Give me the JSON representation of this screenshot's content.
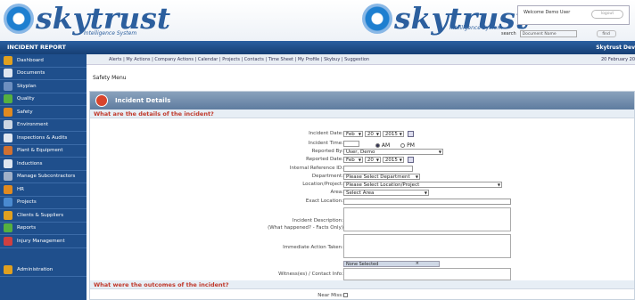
{
  "brand": {
    "name": "skytrust",
    "tagline": "Intelligence System"
  },
  "welcome": {
    "text": "Welcome Demo User",
    "logout_label": "logout"
  },
  "search": {
    "label": "search",
    "placeholder": "Document Name",
    "button": "find"
  },
  "topbar": {
    "title": "INCIDENT REPORT",
    "right": "Skytrust Dev"
  },
  "navlinks": {
    "items": "Alerts  |  My Actions  |  Company Actions  |  Calendar  |  Projects  |  Contacts  |  Time Sheet  |  My Profile  |  Skybuy  |  Suggestion",
    "date": "20 February 20"
  },
  "sidebar": {
    "items": [
      {
        "label": "Dashboard",
        "color": "#e0a020"
      },
      {
        "label": "Documents",
        "color": "#dfe6f0"
      },
      {
        "label": "Skyplan",
        "color": "#6d8fc0"
      },
      {
        "label": "Quality",
        "color": "#55b040"
      },
      {
        "label": "Safety",
        "color": "#e08a20"
      },
      {
        "label": "Environment",
        "color": "#cdd6e2"
      },
      {
        "label": "Inspections & Audits",
        "color": "#dfe6f0"
      },
      {
        "label": "Plant & Equipment",
        "color": "#d07030"
      },
      {
        "label": "Inductions",
        "color": "#dfe6f0"
      },
      {
        "label": "Manage Subcontractors",
        "color": "#a0b0c8"
      },
      {
        "label": "HR",
        "color": "#e08a20"
      },
      {
        "label": "Projects",
        "color": "#4a8ad0"
      },
      {
        "label": "Clients & Suppliers",
        "color": "#e0a020"
      },
      {
        "label": "Reports",
        "color": "#55b040"
      },
      {
        "label": "Injury Management",
        "color": "#d04040"
      }
    ],
    "admin": {
      "label": "Administration",
      "color": "#e0a020"
    }
  },
  "safety_menu": "Safety Menu",
  "panel": {
    "title": "Incident Details"
  },
  "q1": "What are the details of the incident?",
  "q2": "What were the outcomes of the incident?",
  "form": {
    "incident_date": {
      "label": "Incident Date:",
      "month": "Feb",
      "day": "20",
      "year": "2015"
    },
    "incident_time": {
      "label": "Incident Time:",
      "am": "AM",
      "pm": "PM",
      "selected": "AM"
    },
    "reported_by": {
      "label": "Reported By:",
      "value": "User, Demo"
    },
    "reported_date": {
      "label": "Reported Date:",
      "month": "Feb",
      "day": "20",
      "year": "2015"
    },
    "internal_ref": {
      "label": "Internal Reference ID:",
      "value": ""
    },
    "department": {
      "label": "Department:",
      "value": "Please Select Department"
    },
    "location": {
      "label": "Location/Project:",
      "value": "Please Select Location/Project"
    },
    "area": {
      "label": "Area:",
      "value": "Select Area"
    },
    "exact_location": {
      "label": "Exact Location:",
      "value": ""
    },
    "description": {
      "label1": "Incident Description:",
      "label2": "(What happened? - Facts Only)",
      "value": ""
    },
    "immediate_action": {
      "label": "Immediate Action Taken:",
      "value": ""
    },
    "witness": {
      "label": "Witness(es) / Contact Info:",
      "selected": "None Selected"
    },
    "near_miss": {
      "label": "Near Miss:"
    }
  }
}
